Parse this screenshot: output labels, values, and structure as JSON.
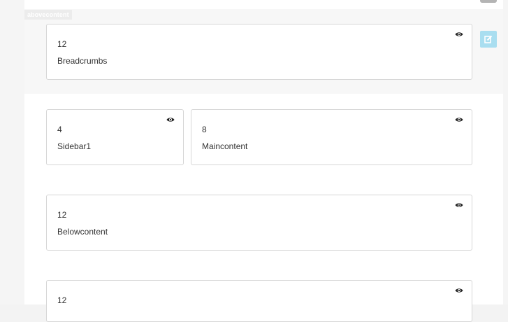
{
  "section": {
    "tag": "abovecontent"
  },
  "blocks": [
    {
      "size": "12",
      "name": "Breadcrumbs"
    },
    {
      "size": "4",
      "name": "Sidebar1"
    },
    {
      "size": "8",
      "name": "Maincontent"
    },
    {
      "size": "12",
      "name": "Belowcontent"
    },
    {
      "size": "12",
      "name": ""
    }
  ],
  "icons": {
    "visibility": "eye-icon",
    "edit": "edit-icon"
  },
  "colors": {
    "edit_button": "#a9def0",
    "border": "#d6d6d6",
    "section_bg": "#f7f7f7"
  }
}
